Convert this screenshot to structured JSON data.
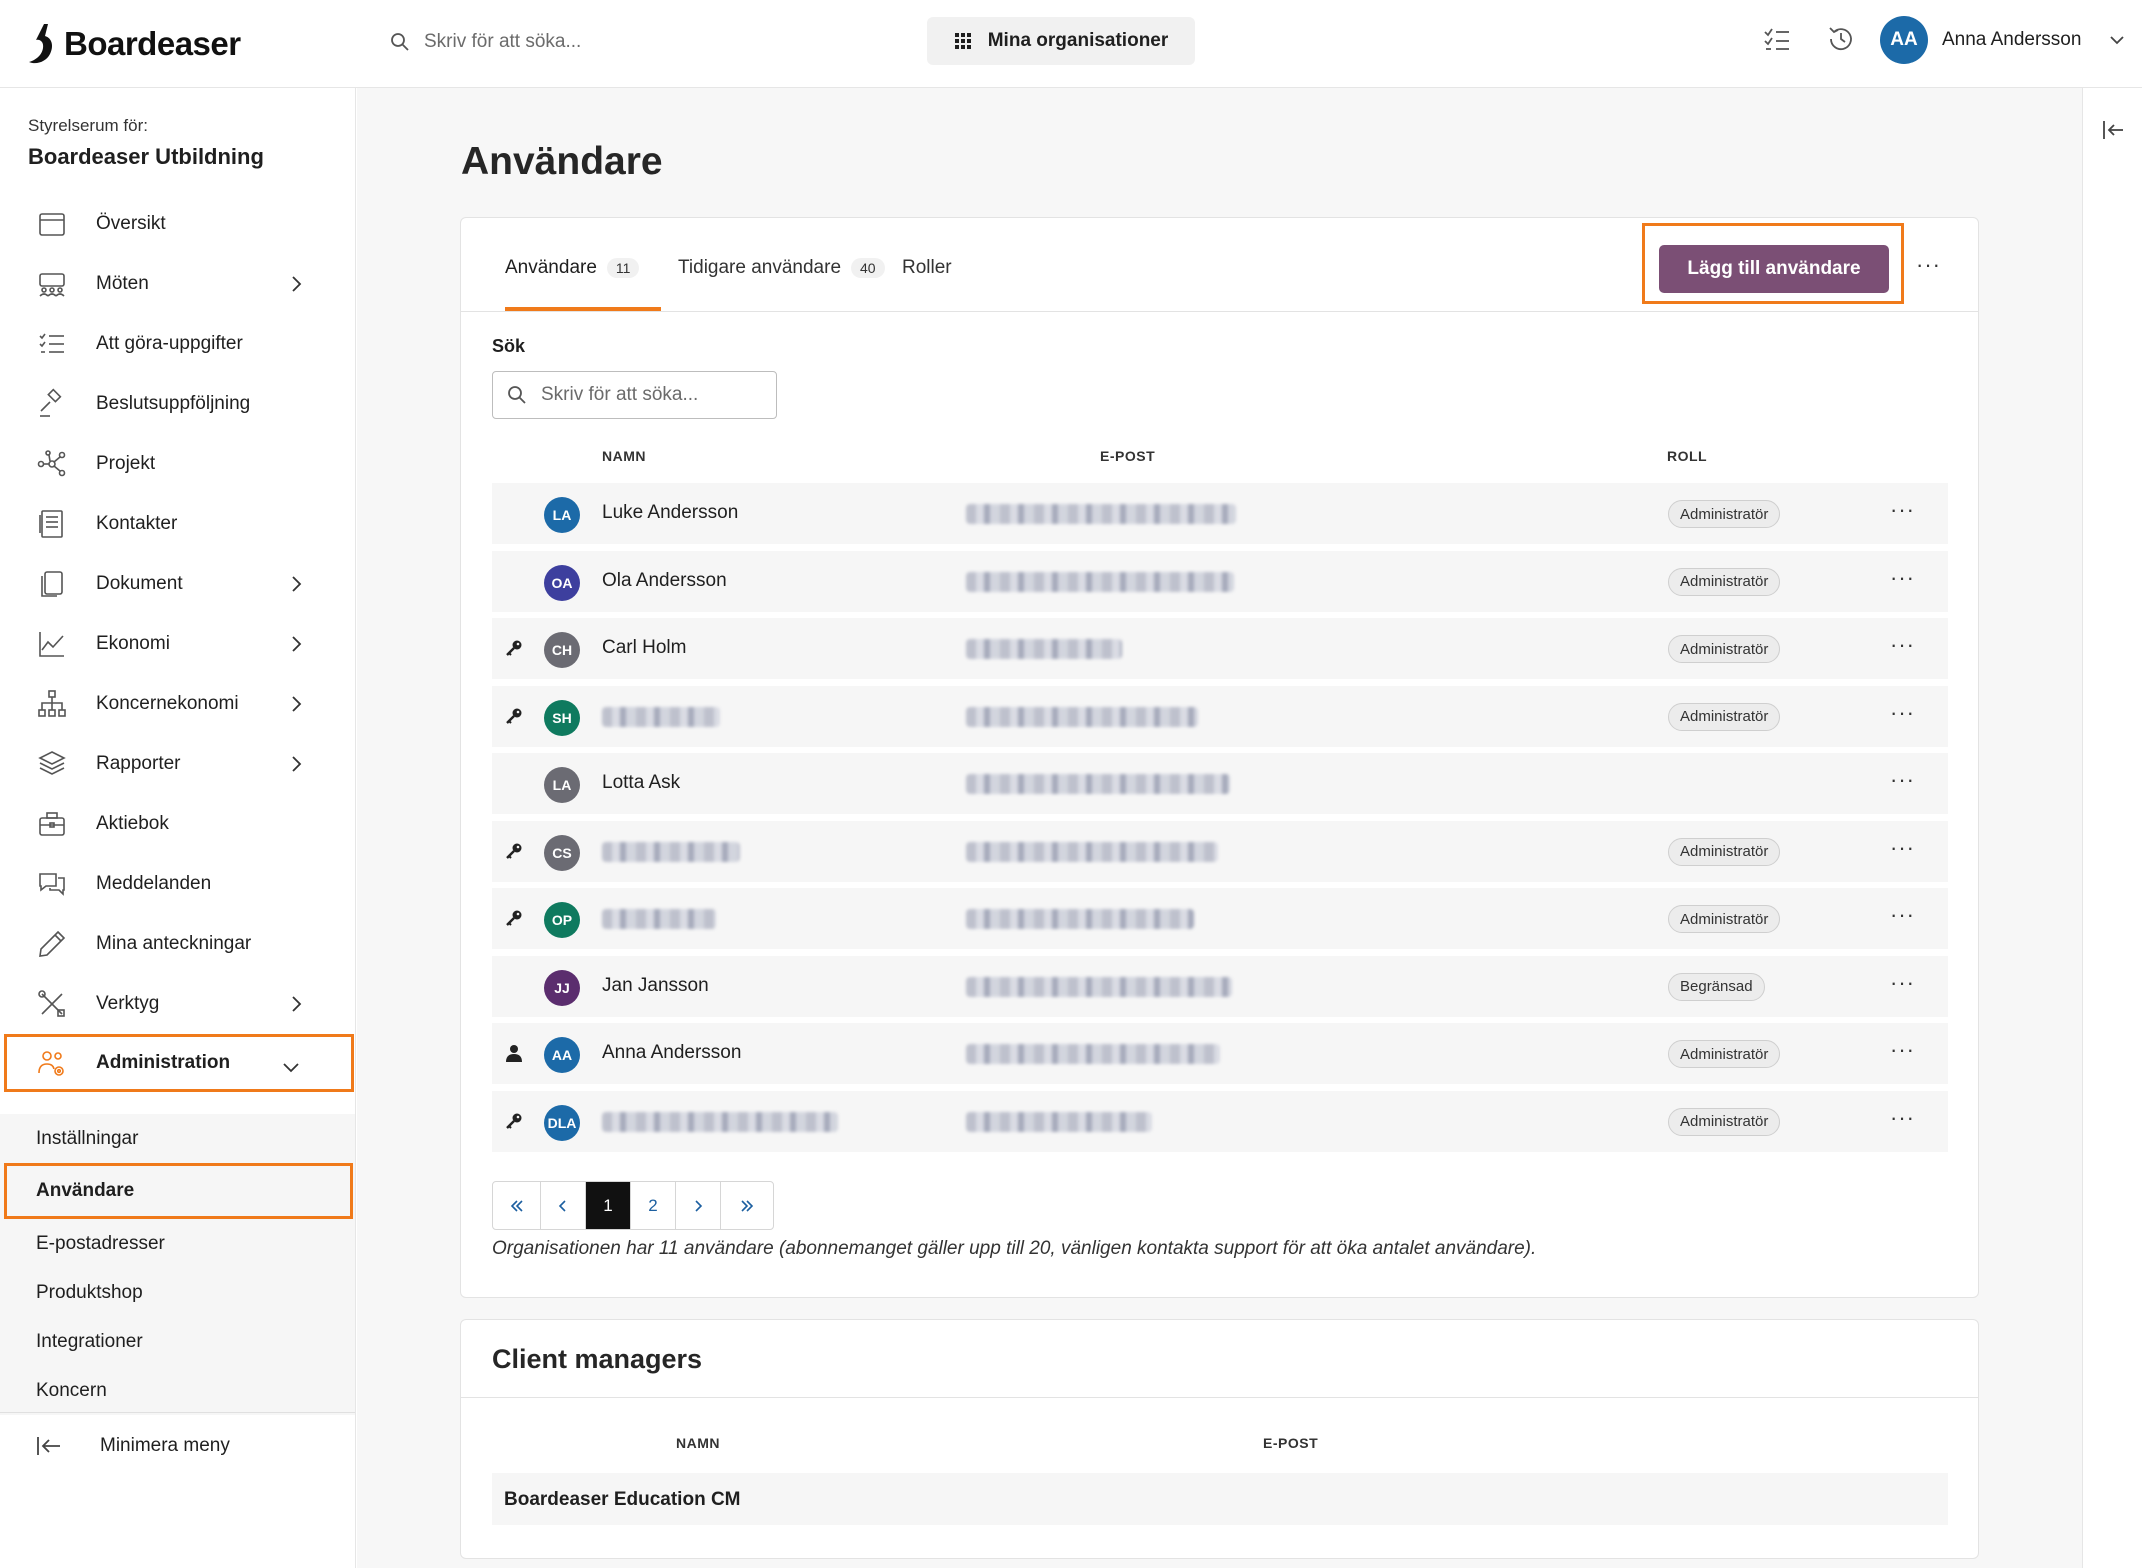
{
  "app": {
    "name": "Boardeaser"
  },
  "topbar": {
    "search_placeholder": "Skriv för att söka...",
    "org_button": "Mina organisationer",
    "user": {
      "initials": "AA",
      "name": "Anna Andersson"
    },
    "icons": [
      "tasks-icon",
      "history-icon",
      "chevron-down-icon"
    ]
  },
  "sidebar": {
    "caption": "Styrelserum för:",
    "org_name": "Boardeaser Utbildning",
    "items": [
      {
        "label": "Översikt",
        "icon": "calendar-icon",
        "chevron": false
      },
      {
        "label": "Möten",
        "icon": "meeting-icon",
        "chevron": true
      },
      {
        "label": "Att göra-uppgifter",
        "icon": "checklist-icon",
        "chevron": false
      },
      {
        "label": "Beslutsuppföljning",
        "icon": "gavel-icon",
        "chevron": false
      },
      {
        "label": "Projekt",
        "icon": "project-icon",
        "chevron": false
      },
      {
        "label": "Kontakter",
        "icon": "contacts-icon",
        "chevron": false
      },
      {
        "label": "Dokument",
        "icon": "document-icon",
        "chevron": true
      },
      {
        "label": "Ekonomi",
        "icon": "chart-icon",
        "chevron": true
      },
      {
        "label": "Koncernekonomi",
        "icon": "org-chart-icon",
        "chevron": true
      },
      {
        "label": "Rapporter",
        "icon": "layers-icon",
        "chevron": true
      },
      {
        "label": "Aktiebok",
        "icon": "briefcase-icon",
        "chevron": false
      },
      {
        "label": "Meddelanden",
        "icon": "chat-icon",
        "chevron": false
      },
      {
        "label": "Mina anteckningar",
        "icon": "pencil-icon",
        "chevron": false
      },
      {
        "label": "Verktyg",
        "icon": "tools-icon",
        "chevron": true
      },
      {
        "label": "Administration",
        "icon": "admin-icon",
        "chevron": true,
        "active": true
      }
    ],
    "subitems": [
      {
        "label": "Inställningar"
      },
      {
        "label": "Användare",
        "active": true
      },
      {
        "label": "E-postadresser"
      },
      {
        "label": "Produktshop"
      },
      {
        "label": "Integrationer"
      },
      {
        "label": "Koncern"
      }
    ],
    "minimize_label": "Minimera meny"
  },
  "main": {
    "title": "Användare",
    "tabs": [
      {
        "label": "Användare",
        "count": "11",
        "active": true
      },
      {
        "label": "Tidigare användare",
        "count": "40"
      },
      {
        "label": "Roller",
        "count": ""
      }
    ],
    "add_button": "Lägg till användare",
    "more_label": "···",
    "search_label": "Sök",
    "search_placeholder": "Skriv för att söka...",
    "columns": {
      "name": "NAMN",
      "email": "E-POST",
      "role": "ROLL"
    },
    "users": [
      {
        "initials": "LA",
        "name": "Luke Andersson",
        "name_hidden": false,
        "role": "Administratör",
        "icon": "",
        "color": "#1c6aa8"
      },
      {
        "initials": "OA",
        "name": "Ola Andersson",
        "name_hidden": false,
        "role": "Administratör",
        "icon": "",
        "color": "#3d3f9e"
      },
      {
        "initials": "CH",
        "name": "Carl Holm",
        "name_hidden": false,
        "role": "Administratör",
        "icon": "key-icon",
        "color": "#6b6b73"
      },
      {
        "initials": "SH",
        "name": "",
        "name_hidden": true,
        "role": "Administratör",
        "icon": "key-icon",
        "color": "#0f7a5f"
      },
      {
        "initials": "LA",
        "name": "Lotta Ask",
        "name_hidden": false,
        "role": "",
        "icon": "",
        "color": "#6b6b73"
      },
      {
        "initials": "CS",
        "name": "",
        "name_hidden": true,
        "role": "Administratör",
        "icon": "key-icon",
        "color": "#6b6b73"
      },
      {
        "initials": "OP",
        "name": "",
        "name_hidden": true,
        "role": "Administratör",
        "icon": "key-icon",
        "color": "#0f7a5f"
      },
      {
        "initials": "JJ",
        "name": "Jan Jansson",
        "name_hidden": false,
        "role": "Begränsad",
        "icon": "",
        "color": "#5b2d6e"
      },
      {
        "initials": "AA",
        "name": "Anna Andersson",
        "name_hidden": false,
        "role": "Administratör",
        "icon": "person-icon",
        "color": "#1c6aa8"
      },
      {
        "initials": "DLA",
        "name": "",
        "name_hidden": true,
        "role": "Administratör",
        "icon": "key-icon",
        "color": "#1c6aa8"
      }
    ],
    "pagination": {
      "pages": [
        "1",
        "2"
      ],
      "current": "1"
    },
    "footnote": "Organisationen har 11 användare (abonnemanget gäller upp till 20, vänligen kontakta support för att öka antalet användare).",
    "client_managers": {
      "title": "Client managers",
      "columns": {
        "name": "NAMN",
        "email": "E-POST"
      },
      "rows": [
        {
          "name": "Boardeaser Education CM",
          "email": ""
        }
      ]
    }
  },
  "colors": {
    "accent": "#f07a1a",
    "primary_button": "#7b4f75",
    "pager_current": "#111111"
  }
}
